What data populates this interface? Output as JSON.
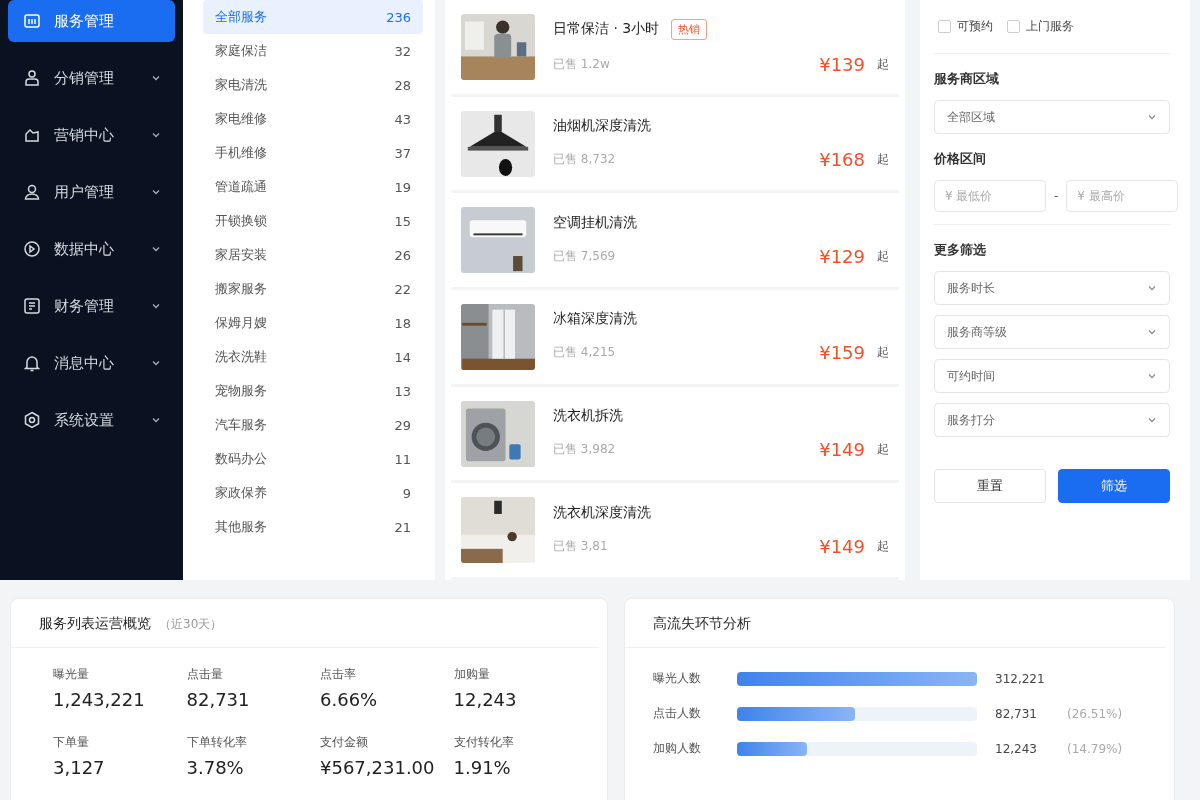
{
  "sidebar": {
    "items": [
      {
        "label": "服务管理",
        "selected": true
      },
      {
        "label": "分销管理",
        "selected": false
      },
      {
        "label": "营销中心",
        "selected": false
      },
      {
        "label": "用户管理",
        "selected": false
      },
      {
        "label": "数据中心",
        "selected": false
      },
      {
        "label": "财务管理",
        "selected": false
      },
      {
        "label": "消息中心",
        "selected": false
      },
      {
        "label": "系统设置",
        "selected": false
      }
    ]
  },
  "categories": [
    {
      "label": "全部服务",
      "count": "236",
      "selected": true
    },
    {
      "label": "家庭保洁",
      "count": "32",
      "selected": false
    },
    {
      "label": "家电清洗",
      "count": "28",
      "selected": false
    },
    {
      "label": "家电维修",
      "count": "43",
      "selected": false
    },
    {
      "label": "手机维修",
      "count": "37",
      "selected": false
    },
    {
      "label": "管道疏通",
      "count": "19",
      "selected": false
    },
    {
      "label": "开锁换锁",
      "count": "15",
      "selected": false
    },
    {
      "label": "家居安装",
      "count": "26",
      "selected": false
    },
    {
      "label": "搬家服务",
      "count": "22",
      "selected": false
    },
    {
      "label": "保姆月嫂",
      "count": "18",
      "selected": false
    },
    {
      "label": "洗衣洗鞋",
      "count": "14",
      "selected": false
    },
    {
      "label": "宠物服务",
      "count": "13",
      "selected": false
    },
    {
      "label": "汽车服务",
      "count": "29",
      "selected": false
    },
    {
      "label": "数码办公",
      "count": "11",
      "selected": false
    },
    {
      "label": "家政保养",
      "count": "9",
      "selected": false
    },
    {
      "label": "其他服务",
      "count": "21",
      "selected": false
    }
  ],
  "products": [
    {
      "title": "日常保洁 · 3小时",
      "tag": "热销",
      "sold": "已售 1.2w",
      "price": "¥139",
      "suffix": "起"
    },
    {
      "title": "油烟机深度清洗",
      "sold": "已售 8,732",
      "price": "¥168",
      "suffix": "起"
    },
    {
      "title": "空调挂机清洗",
      "sold": "已售 7,569",
      "price": "¥129",
      "suffix": "起"
    },
    {
      "title": "冰箱深度清洗",
      "sold": "已售 4,215",
      "price": "¥159",
      "suffix": "起"
    },
    {
      "title": "洗衣机拆洗",
      "sold": "已售 3,982",
      "price": "¥149",
      "suffix": "起"
    },
    {
      "title": "洗衣机深度清洗",
      "sold": "已售 3,81",
      "price": "¥149",
      "suffix": "起"
    }
  ],
  "filters": {
    "checkboxes": [
      {
        "label": "可预约",
        "checked": false
      },
      {
        "label": "上门服务",
        "checked": false
      }
    ],
    "region": {
      "title": "服务商区域",
      "value": "全部区域"
    },
    "price": {
      "title": "价格区间",
      "min_placeholder": "¥ 最低价",
      "separator": "-",
      "max_placeholder": "¥ 最高价"
    },
    "more": {
      "title": "更多筛选",
      "selects": [
        "服务时长",
        "服务商等级",
        "可约时间",
        "服务打分"
      ]
    },
    "buttons": [
      {
        "label": "重置",
        "kind": "secondary"
      },
      {
        "label": "筛选",
        "kind": "primary"
      }
    ]
  },
  "overview": {
    "title": "服务列表运营概览",
    "subtitle": "（近30天）",
    "metrics": [
      {
        "label": "曝光量",
        "value": "1,243,221"
      },
      {
        "label": "点击量",
        "value": "82,731"
      },
      {
        "label": "点击率",
        "value": "6.66%"
      },
      {
        "label": "加购量",
        "value": "12,243"
      },
      {
        "label": "下单量",
        "value": "3,127"
      },
      {
        "label": "下单转化率",
        "value": "3.78%"
      },
      {
        "label": "支付金额",
        "value": "¥567,231.00"
      },
      {
        "label": "支付转化率",
        "value": "1.91%"
      }
    ]
  },
  "funnel": {
    "title": "高流失环节分析",
    "rows": [
      {
        "label": "曝光人数",
        "value": "312,221",
        "level": 1
      },
      {
        "label": "点击人数",
        "value": "82,731",
        "percent": "(26.51%)",
        "level": 0.49
      },
      {
        "label": "加购人数",
        "value": "12,243",
        "percent": "(14.79%)",
        "level": 0.29
      }
    ]
  }
}
